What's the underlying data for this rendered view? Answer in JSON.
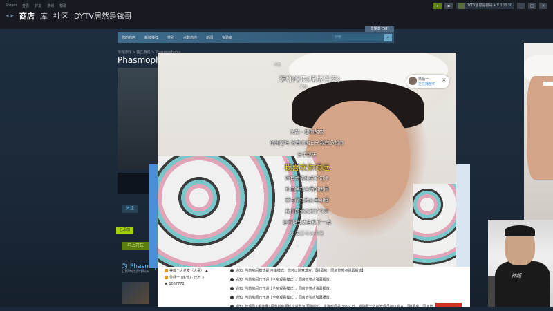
{
  "client": {
    "menu": [
      "Steam",
      "查看",
      "好友",
      "游戏",
      "帮助"
    ],
    "nav": [
      "商店",
      "库",
      "社区",
      "DYTV居然是铉哥"
    ],
    "user_label": "DYTV居然是铉哥 • ¥ 103.30",
    "window_buttons": [
      "_",
      "□",
      "×"
    ]
  },
  "store": {
    "wishlist": "愿望单 (58)",
    "nav": [
      "您的商店",
      "新鲜推荐",
      "类别",
      "点数商店",
      "新闻",
      "实验室"
    ],
    "search_placeholder": "搜索",
    "breadcrumb": "所有游戏 > 独立游戏 > Phasmophobia",
    "game_title": "Phasmophobia",
    "follow": "关注",
    "badge": "已添加",
    "buy": "马上开玩",
    "promo_title": "为 Phasmophobia",
    "promo_desc": "立即为此游戏购买"
  },
  "player": {
    "top_left": "斗鱼",
    "song_title": "想你的夜(原版伴奏)",
    "song_subtitle": "关喆",
    "popup_title": "猜猜一",
    "popup_sub": "正在播放中",
    "lyrics_before": [
      "关喆 - 想你的夜",
      "你知道吗 没有你的日子我有多想你",
      "分手那天"
    ],
    "lyric_current": "我喜欢你很远",
    "lyrics_after": [
      "所有承诺化成了句点",
      "和白字在空荡的房间",
      "爱与痛在我心里纠缠",
      "我们的爱走到了今天",
      "是不是我太自私了一点",
      "如果爱可以重来"
    ]
  },
  "chat": {
    "users": [
      {
        "name": "美度个大老麦（大哥）",
        "tail": "▲"
      },
      {
        "name": "梦啊一",
        "tail": "(房管) · 已开 »"
      }
    ],
    "count": "1067772",
    "notices": [
      "通知: 当前房间模式是 自由模式，您可以随意发言。【弹幕房、同房管签点弹幕播放】",
      "通知: 当前房间已开通【全房观看模式】，同房管签点弹幕播放。",
      "通知: 当前房间已开通【全房观看模式】，同房管签点弹幕播放。",
      "通知: 当前房间已开通【全房观看模式】，同房管签点弹幕播放。",
      "通知: 管理员 [手游鹰] 把当前房间模式设置为 更弹模式，发弹时间是 9999 秒。发弹幕一人控管理员可以发言。【弹幕房、同房管"
    ]
  },
  "webcam": {
    "shirt_text": "神超"
  }
}
